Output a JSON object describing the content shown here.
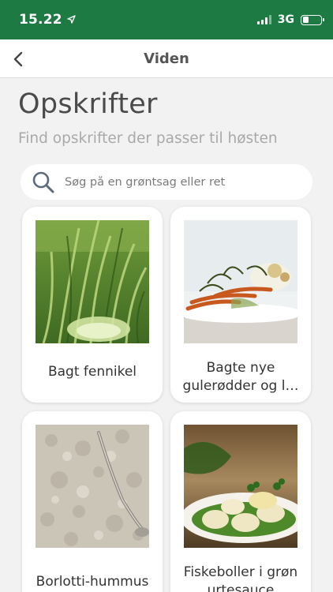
{
  "status_bar": {
    "time": "15.22",
    "network": "3G",
    "battery_level": 0.35
  },
  "nav": {
    "title": "Viden",
    "back_icon": "chevron-left-icon"
  },
  "page": {
    "title": "Opskrifter",
    "subtitle": "Find opskrifter der passer til høsten"
  },
  "search": {
    "placeholder": "Søg på en grøntsag eller ret",
    "value": ""
  },
  "recipes": [
    {
      "label": "Bagt fennikel",
      "image": "fennel-photo"
    },
    {
      "label": "Bagte nye gulerødder og l…",
      "image": "carrots-dish-photo"
    },
    {
      "label": "Borlotti-hummus",
      "image": "hummus-photo"
    },
    {
      "label": "Fiskeboller i grøn urtesauce",
      "image": "fish-balls-photo"
    }
  ],
  "colors": {
    "status_bar": "#1e7a43",
    "background": "#f2f2f2",
    "card": "#ffffff"
  }
}
